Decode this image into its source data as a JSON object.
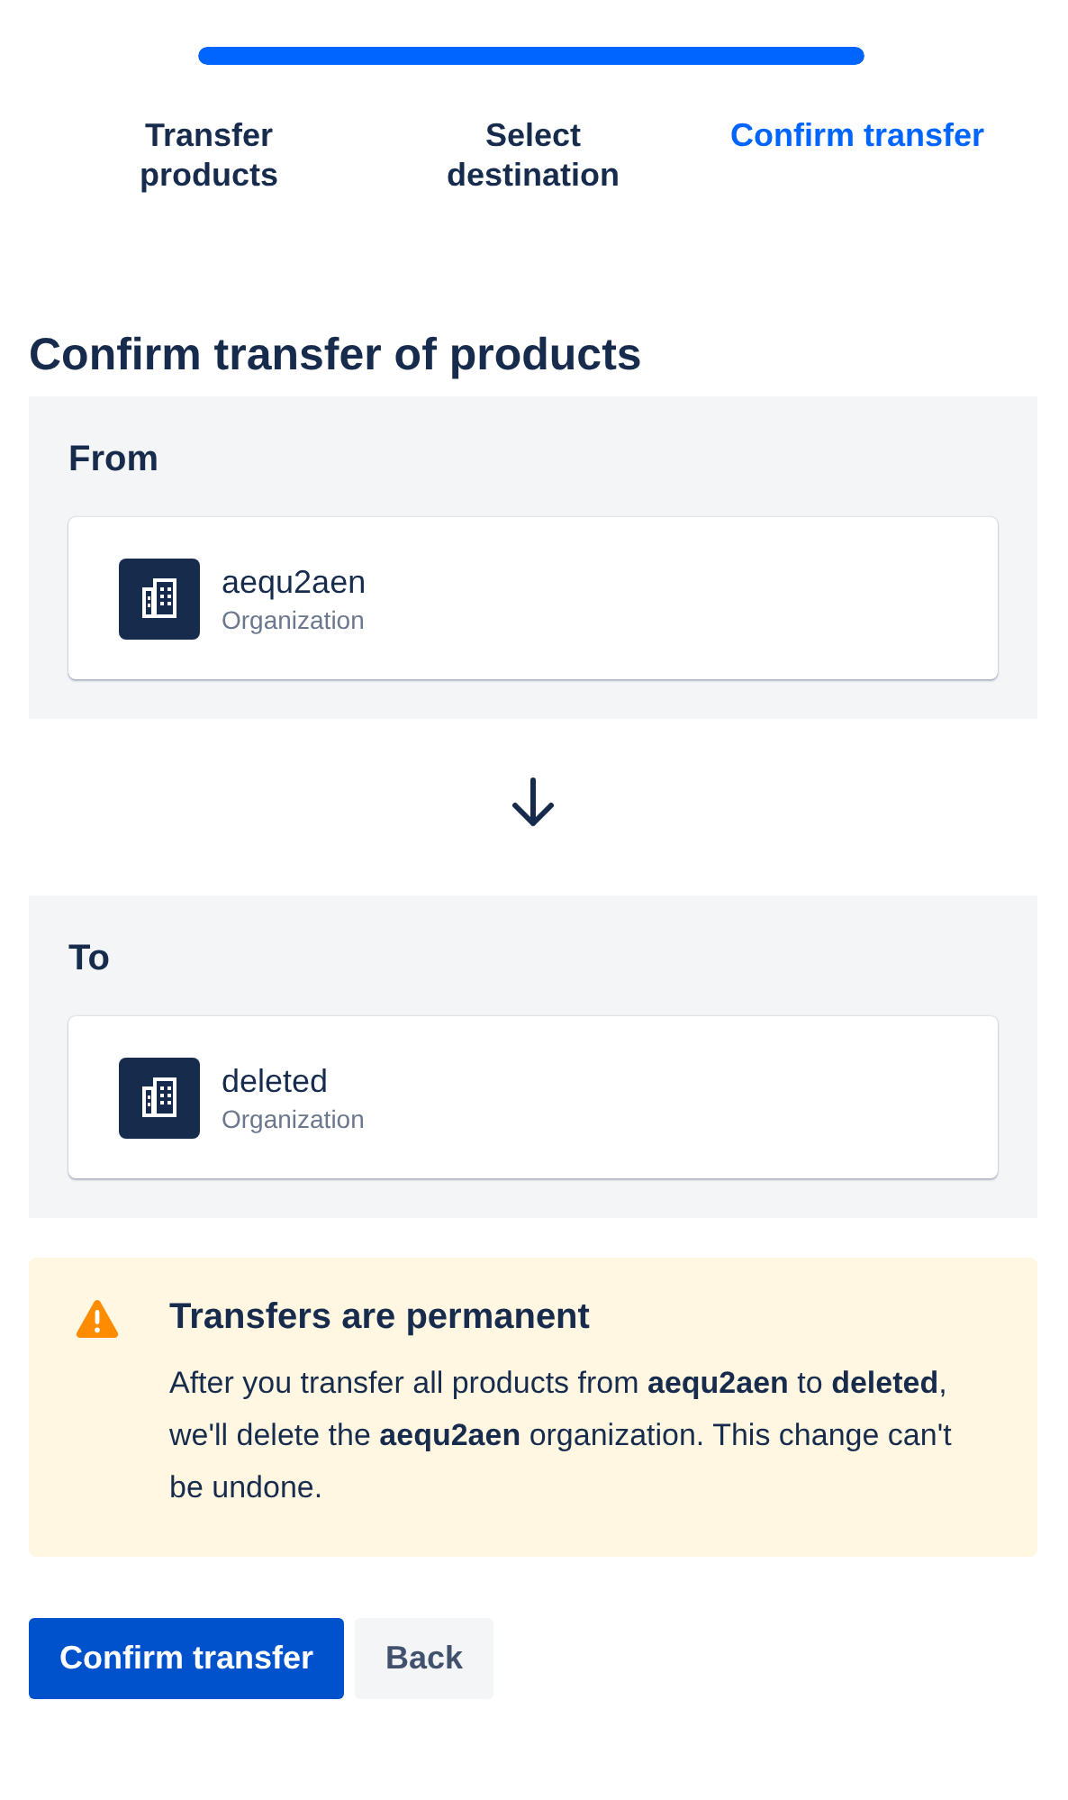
{
  "progress": {
    "level": 1
  },
  "steps": [
    {
      "label": "Transfer products",
      "selected": false
    },
    {
      "label": "Select destination",
      "selected": false
    },
    {
      "label": "Confirm transfer",
      "selected": true
    }
  ],
  "title": "Confirm transfer of products",
  "from": {
    "label": "From",
    "name": "aequ2aen",
    "type": "Organization"
  },
  "to": {
    "label": "To",
    "name": "deleted",
    "type": "Organization"
  },
  "warning": {
    "title": "Transfers are permanent",
    "body": "After you transfer all products from **aequ2aen** to **deleted**, we'll delete the **aequ2aen** organization. This change can't be undone."
  },
  "buttons": [
    {
      "label": "Confirm transfer",
      "kind": "primary"
    },
    {
      "label": "Back",
      "kind": "secondary"
    }
  ]
}
